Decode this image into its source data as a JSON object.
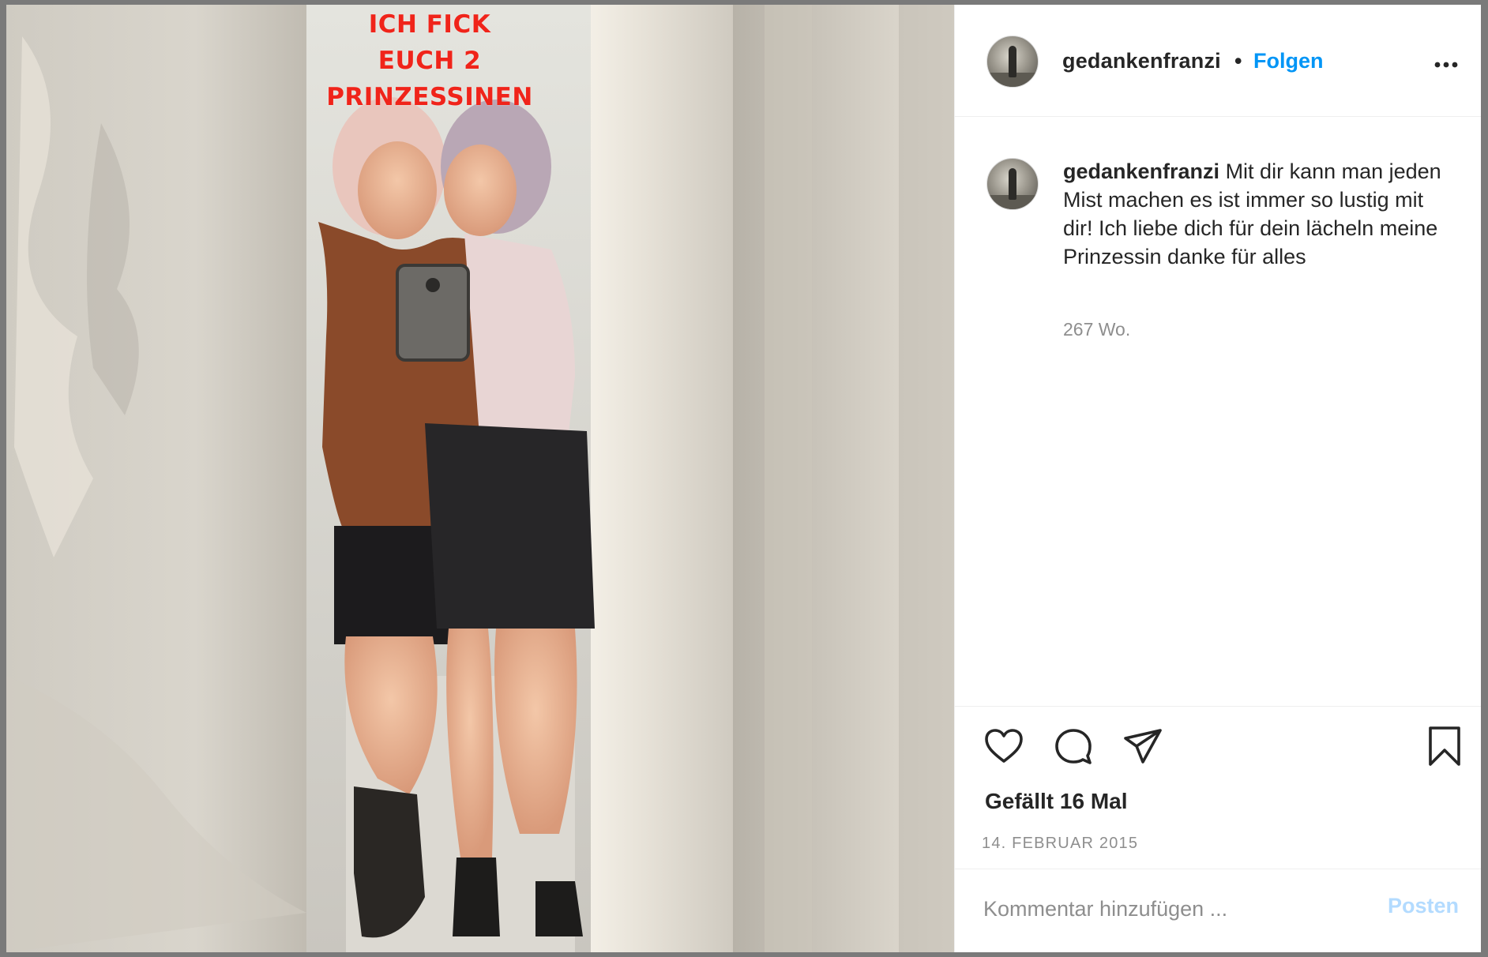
{
  "photo": {
    "overlay_lines": [
      "ICH FICK",
      "EUCH 2",
      "PRINZESSINEN"
    ]
  },
  "header": {
    "username": "gedankenfranzi",
    "separator": "•",
    "follow_label": "Folgen",
    "more_icon": "more-horizontal-icon"
  },
  "caption": {
    "username": "gedankenfranzi",
    "text": "Mit dir kann man jeden Mist machen es ist immer so lustig mit dir! Ich liebe dich für dein lächeln meine Prinzessin danke für alles",
    "age": "267 Wo."
  },
  "actions": {
    "icons": [
      "heart-icon",
      "comment-icon",
      "share-icon",
      "bookmark-icon"
    ],
    "likes": "Gefällt 16 Mal",
    "date": "14. FEBRUAR 2015"
  },
  "comment": {
    "placeholder": "Kommentar hinzufügen ...",
    "post_label": "Posten"
  },
  "colors": {
    "accent": "#0095f6",
    "overlay_text": "#f0241a",
    "post_disabled": "#b3dbff"
  }
}
